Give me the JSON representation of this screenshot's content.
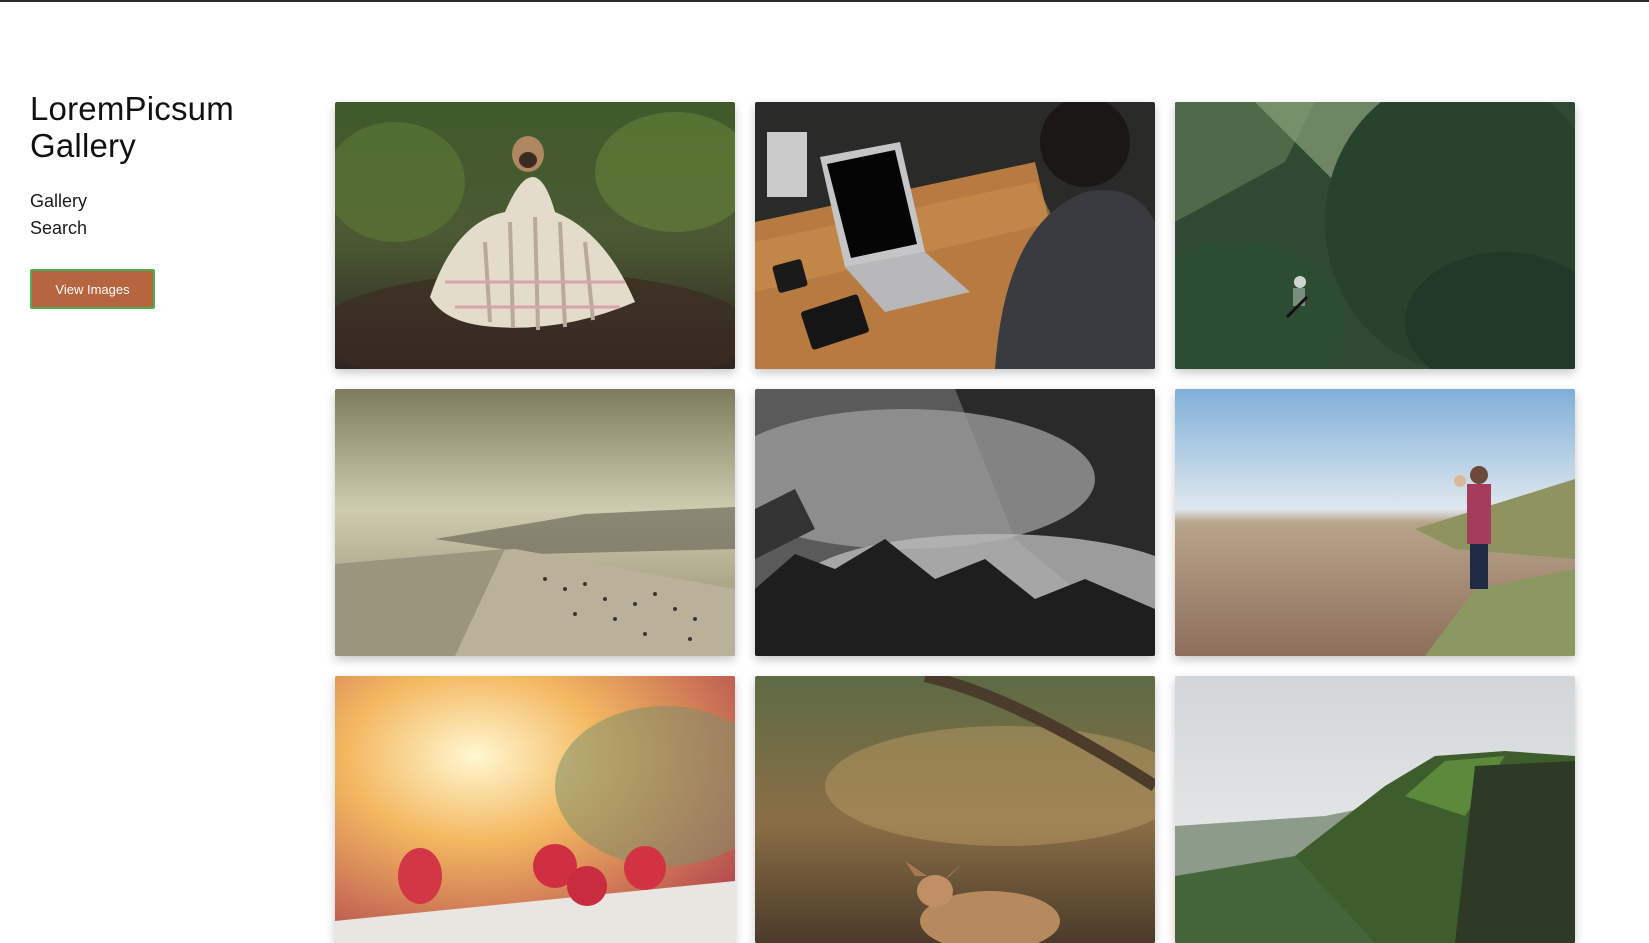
{
  "site": {
    "title": "LoremPicsum Gallery"
  },
  "nav": {
    "items": [
      {
        "label": "Gallery"
      },
      {
        "label": "Search"
      }
    ]
  },
  "actions": {
    "view_images_label": "View Images"
  },
  "gallery": {
    "images": [
      {
        "subject": "pug-wrapped-in-blanket"
      },
      {
        "subject": "person-with-laptop"
      },
      {
        "subject": "mountain-biker-in-forest"
      },
      {
        "subject": "hazy-beach-crowd"
      },
      {
        "subject": "misty-forest-bw"
      },
      {
        "subject": "father-and-child-on-beach"
      },
      {
        "subject": "raspberries"
      },
      {
        "subject": "fawn-in-forest"
      },
      {
        "subject": "green-cliffs"
      }
    ]
  },
  "colors": {
    "button_bg": "#b7653e",
    "button_border": "#4caf50",
    "top_rule": "#2b2b2b"
  }
}
